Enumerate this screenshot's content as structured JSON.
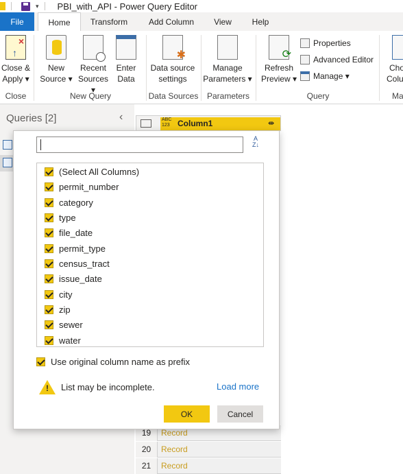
{
  "titlebar": {
    "title": "PBI_with_API - Power Query Editor",
    "save_icon": "save-icon",
    "qat_dropdown": "▾"
  },
  "tabs": [
    {
      "label": "File"
    },
    {
      "label": "Home"
    },
    {
      "label": "Transform"
    },
    {
      "label": "Add Column"
    },
    {
      "label": "View"
    },
    {
      "label": "Help"
    }
  ],
  "ribbon": {
    "close_apply": {
      "line1": "Close &",
      "line2": "Apply ▾"
    },
    "new_source": {
      "line1": "New",
      "line2": "Source ▾"
    },
    "recent_sources": {
      "line1": "Recent",
      "line2": "Sources ▾"
    },
    "enter_data": {
      "line1": "Enter",
      "line2": "Data"
    },
    "data_source_settings": {
      "line1": "Data source",
      "line2": "settings"
    },
    "manage_parameters": {
      "line1": "Manage",
      "line2": "Parameters ▾"
    },
    "refresh_preview": {
      "line1": "Refresh",
      "line2": "Preview ▾"
    },
    "properties": "Properties",
    "advanced_editor": "Advanced Editor",
    "manage": "Manage ▾",
    "choose_columns": {
      "line1": "Cho",
      "line2": "Colum"
    },
    "groups": {
      "close": "Close",
      "new_query": "New Query",
      "data_sources": "Data Sources",
      "parameters": "Parameters",
      "query": "Query",
      "manage_columns": "Ma"
    }
  },
  "queries_pane": {
    "label": "Queries [2]",
    "collapse": "‹"
  },
  "grid": {
    "type_label": "ABC\n123",
    "column_name": "Column1",
    "expand_glyph": "⇼",
    "rows": [
      {
        "num": "19",
        "value": "Record"
      },
      {
        "num": "20",
        "value": "Record"
      },
      {
        "num": "21",
        "value": "Record"
      }
    ]
  },
  "popup": {
    "search_value": "",
    "sort_glyph": "A↓Z",
    "columns": [
      "(Select All Columns)",
      "permit_number",
      "category",
      "type",
      "file_date",
      "permit_type",
      "census_tract",
      "issue_date",
      "city",
      "zip",
      "sewer",
      "water"
    ],
    "prefix_label": "Use original column name as prefix",
    "warning": "List may be incomplete.",
    "warning_glyph": "!",
    "load_more": "Load more",
    "ok": "OK",
    "cancel": "Cancel"
  },
  "colors": {
    "accent": "#f2c811",
    "file_tab": "#1a73c8",
    "link": "#1a73c8",
    "record_text": "#c89c1e"
  }
}
